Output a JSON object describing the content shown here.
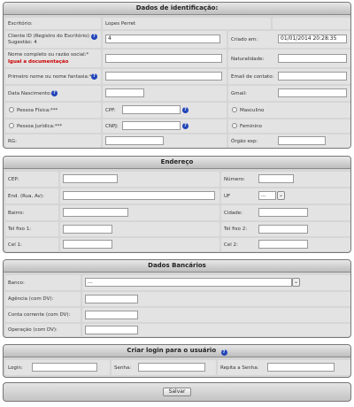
{
  "identificacao": {
    "title": "Dados de identificação:",
    "escritorio_label": "Escritório:",
    "escritorio_value": "Lopes Perret",
    "cliente_label_1": "Cliente ID (Registro do Escritório):",
    "cliente_label_2": "Sugestão: 4",
    "cliente_value": "4",
    "criado_label": "Criado em:",
    "criado_value": "01/01/2014 20:28:35",
    "nome_label": "Nome completo ou razão social:*",
    "nome_warning": "Igual a documentação",
    "naturalidade_label": "Naturalidade:",
    "primeiro_nome_label": "Primeiro nome ou nome fantasia:*",
    "email_label": "Email de contato:",
    "nascimento_label": "Data Nascimento:",
    "gmail_label": "Gmail:",
    "pessoa_fisica_label": "Pessoa Física:***",
    "cpf_label": "CPF:",
    "masculino_label": "Masculino",
    "pessoa_juridica_label": "Pessoa Jurídica:***",
    "cnpj_label": "CNPJ:",
    "feminino_label": "Feminino",
    "rg_label": "RG:",
    "orgao_label": "Órgão exp:"
  },
  "endereco": {
    "title": "Endereço",
    "cep_label": "CEP:",
    "numero_label": "Número:",
    "end_label": "End. (Rua, Av):",
    "uf_label": "UF",
    "uf_value": "...",
    "bairro_label": "Bairro:",
    "cidade_label": "Cidade:",
    "tel1_label": "Tel fixo 1:",
    "tel2_label": "Tel fixo 2:",
    "cel1_label": "Cel 1:",
    "cel2_label": "Cel 2:"
  },
  "bancarios": {
    "title": "Dados Bancários",
    "banco_label": "Banco:",
    "banco_value": "...",
    "agencia_label": "Agência (com DV):",
    "conta_label": "Conta corrente (com DV):",
    "operacao_label": "Operação (com DV):"
  },
  "login": {
    "title": "Criar login para o usuário",
    "login_label": "Login:",
    "senha_label": "Senha:",
    "repita_label": "Repita a Senha:"
  },
  "actions": {
    "save_label": "Salvar"
  },
  "icons": {
    "help_glyph": "?",
    "chevron_glyph": "⌄"
  }
}
